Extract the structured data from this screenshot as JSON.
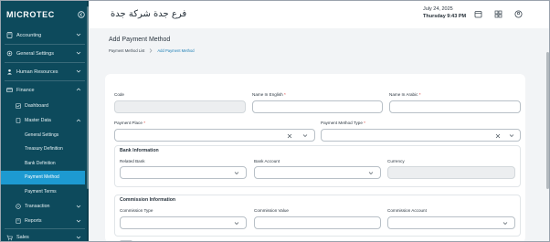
{
  "app": {
    "logo": "MICROTEC",
    "branch_title": "فرع جدة شركة جدة",
    "date": "July 24, 2025",
    "day_time": "Thursday  9:43 PM"
  },
  "sidebar": {
    "items": [
      {
        "label": "Accounting",
        "icon": "calculator-icon"
      },
      {
        "label": "General Settings",
        "icon": "gear-icon"
      },
      {
        "label": "Human Resources",
        "icon": "people-icon"
      },
      {
        "label": "Finance",
        "icon": "wallet-icon"
      }
    ],
    "finance_children": [
      {
        "label": "Dashboard"
      },
      {
        "label": "Master Data"
      }
    ],
    "master_data_children": [
      {
        "label": "General Settings"
      },
      {
        "label": "Treasury Definition"
      },
      {
        "label": "Bank Definition"
      },
      {
        "label": "Payment Method",
        "active": true
      },
      {
        "label": "Payment Terms"
      }
    ],
    "more_children": [
      {
        "label": "Transaction"
      },
      {
        "label": "Reports"
      }
    ],
    "bottom_items": [
      {
        "label": "Sales",
        "icon": "cart-icon"
      }
    ]
  },
  "page": {
    "title": "Add Payment Method",
    "breadcrumb": [
      "Payment Method List",
      "Add Payment Method"
    ]
  },
  "form": {
    "code_label": "Code",
    "name_en_label": "Name In English",
    "name_ar_label": "Name In Arabic",
    "payment_place_label": "Payment Place",
    "payment_method_type_label": "Payment Method Type",
    "required_mark": "*",
    "bank_section_title": "Bank Information",
    "related_bank_label": "Related Bank",
    "bank_account_label": "Bank Account",
    "currency_label": "Currency",
    "commission_section_title": "Commission Information",
    "commission_type_label": "Commission Type",
    "commission_value_label": "Commission Value",
    "commission_account_label": "Commission Account"
  },
  "colors": {
    "sidebar_bg": "#0d4a5c",
    "active_item": "#1d9ad1",
    "required": "#d9302c",
    "breadcrumb_current": "#1d7fb5"
  }
}
